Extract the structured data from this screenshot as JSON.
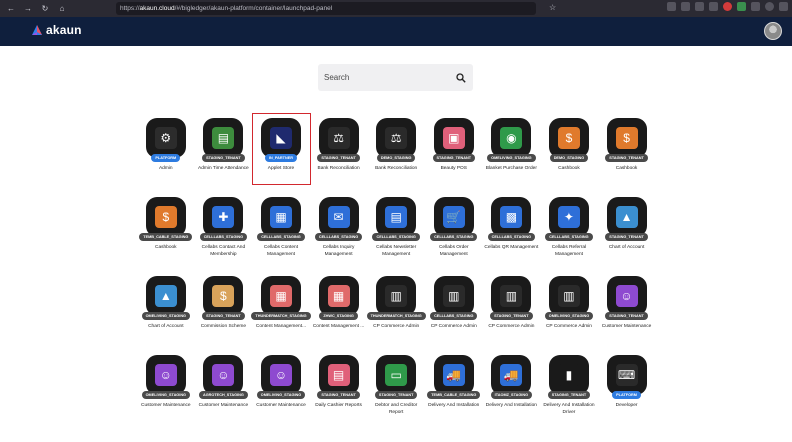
{
  "browser": {
    "url_prefix": "https://",
    "url_host": "akaun.cloud",
    "url_path": "/#/bigledger/akaun-platform/container/launchpad-panel"
  },
  "app": {
    "brand": "akaun"
  },
  "search": {
    "placeholder": "Search"
  },
  "apps": [
    {
      "label": "Admin",
      "badge": "PLATFORM",
      "badge_color": "#2d7be0",
      "icon_bg": "#2c2c2c",
      "glyph": "⚙"
    },
    {
      "label": "Admin Time Attendance",
      "badge": "STAGING_TENANT",
      "badge_color": "#4a4a4a",
      "icon_bg": "#3d8c3d",
      "glyph": "▤"
    },
    {
      "label": "Applet Store",
      "badge": "IN_PARTNER",
      "badge_color": "#2d7be0",
      "icon_bg": "#1f2a6e",
      "glyph": "◣",
      "selected": true
    },
    {
      "label": "Bank Reconciliation",
      "badge": "STAGING_TENANT",
      "badge_color": "#4a4a4a",
      "icon_bg": "#2a2a2a",
      "glyph": "⚖"
    },
    {
      "label": "Bank Reconciliation",
      "badge": "DEMO_STAGING",
      "badge_color": "#4a4a4a",
      "icon_bg": "#2a2a2a",
      "glyph": "⚖"
    },
    {
      "label": "Beauty POS",
      "badge": "STAGING_TENANT",
      "badge_color": "#4a4a4a",
      "icon_bg": "#e0607a",
      "glyph": "▣"
    },
    {
      "label": "Blanket Purchase Order",
      "badge": "OMELIVING_STAGING",
      "badge_color": "#4a4a4a",
      "icon_bg": "#2f9a4a",
      "glyph": "◉"
    },
    {
      "label": "Cashbook",
      "badge": "DEMO_STAGING",
      "badge_color": "#4a4a4a",
      "icon_bg": "#e07a2c",
      "glyph": "$"
    },
    {
      "label": "Cashbook",
      "badge": "STAGING_TENANT",
      "badge_color": "#4a4a4a",
      "icon_bg": "#e07a2c",
      "glyph": "$"
    },
    {
      "label": "Cashbook",
      "badge": "TEMB_CABLE_STAGING",
      "badge_color": "#4a4a4a",
      "icon_bg": "#e07a2c",
      "glyph": "$"
    },
    {
      "label": "Cellabs Contact And Membership",
      "badge": "CELLLABS_STAGING",
      "badge_color": "#4a4a4a",
      "icon_bg": "#2e6fd8",
      "glyph": "✚"
    },
    {
      "label": "Cellabs Content Management",
      "badge": "CELLLABS_STAGING",
      "badge_color": "#4a4a4a",
      "icon_bg": "#2e6fd8",
      "glyph": "▦"
    },
    {
      "label": "Cellabs Inquiry Management",
      "badge": "CELLLABS_STAGING",
      "badge_color": "#4a4a4a",
      "icon_bg": "#2e6fd8",
      "glyph": "✉"
    },
    {
      "label": "Cellabs Newsletter Management",
      "badge": "CELLLABS_STAGING",
      "badge_color": "#4a4a4a",
      "icon_bg": "#2e6fd8",
      "glyph": "▤"
    },
    {
      "label": "Cellabs Order Management",
      "badge": "CELLLABS_STAGING",
      "badge_color": "#4a4a4a",
      "icon_bg": "#2e6fd8",
      "glyph": "🛒"
    },
    {
      "label": "Cellabs QR Management",
      "badge": "CELLLABS_STAGING",
      "badge_color": "#4a4a4a",
      "icon_bg": "#2e6fd8",
      "glyph": "▩"
    },
    {
      "label": "Cellabs Referral Management",
      "badge": "CELLLABS_STAGING",
      "badge_color": "#4a4a4a",
      "icon_bg": "#2e6fd8",
      "glyph": "✦"
    },
    {
      "label": "Chart of Account",
      "badge": "STAGING_TENANT",
      "badge_color": "#4a4a4a",
      "icon_bg": "#3b8fd0",
      "glyph": "▲"
    },
    {
      "label": "Chart of Account",
      "badge": "OMELIVING_STAGING",
      "badge_color": "#4a4a4a",
      "icon_bg": "#3b8fd0",
      "glyph": "▲"
    },
    {
      "label": "Commission Scheme",
      "badge": "STAGING_TENANT",
      "badge_color": "#4a4a4a",
      "icon_bg": "#d9a35a",
      "glyph": "$"
    },
    {
      "label": "Content Management...",
      "badge": "THUNDERMATCH_STAGING",
      "badge_color": "#4a4a4a",
      "icon_bg": "#e06a6a",
      "glyph": "▦"
    },
    {
      "label": "Content Management ...",
      "badge": "ZHWC_STAGING",
      "badge_color": "#4a4a4a",
      "icon_bg": "#e06a6a",
      "glyph": "▦"
    },
    {
      "label": "CP Commerce Admin",
      "badge": "THUNDERMATCH_STAGING",
      "badge_color": "#4a4a4a",
      "icon_bg": "#2a2a2a",
      "glyph": "▥"
    },
    {
      "label": "CP Commerce Admin",
      "badge": "CELLLABS_STAGING",
      "badge_color": "#4a4a4a",
      "icon_bg": "#2a2a2a",
      "glyph": "▥"
    },
    {
      "label": "CP Commerce Admin",
      "badge": "STAGING_TENANT",
      "badge_color": "#4a4a4a",
      "icon_bg": "#2a2a2a",
      "glyph": "▥"
    },
    {
      "label": "CP Commerce Admin",
      "badge": "OMELIVING_STAGING",
      "badge_color": "#4a4a4a",
      "icon_bg": "#2a2a2a",
      "glyph": "▥"
    },
    {
      "label": "Customer Maintenance",
      "badge": "STAGING_TENANT",
      "badge_color": "#4a4a4a",
      "icon_bg": "#8e4ad0",
      "glyph": "☺"
    },
    {
      "label": "Customer Maintenance",
      "badge": "OMELIVING_STAGING",
      "badge_color": "#4a4a4a",
      "icon_bg": "#8e4ad0",
      "glyph": "☺"
    },
    {
      "label": "Customer Maintenance",
      "badge": "AGROTECH_STAGING",
      "badge_color": "#4a4a4a",
      "icon_bg": "#8e4ad0",
      "glyph": "☺"
    },
    {
      "label": "Customer Maintenance",
      "badge": "OMELIVING_STAGING",
      "badge_color": "#4a4a4a",
      "icon_bg": "#8e4ad0",
      "glyph": "☺"
    },
    {
      "label": "Daily Cashier Reports",
      "badge": "STAGING_TENANT",
      "badge_color": "#4a4a4a",
      "icon_bg": "#e0607a",
      "glyph": "▤"
    },
    {
      "label": "Debtor and Creditor Report",
      "badge": "STAGING_TENANT",
      "badge_color": "#4a4a4a",
      "icon_bg": "#2f9a4a",
      "glyph": "▭"
    },
    {
      "label": "Delivery And Installation",
      "badge": "TEMB_CABLE_STAGING",
      "badge_color": "#4a4a4a",
      "icon_bg": "#2e6fd8",
      "glyph": "🚚"
    },
    {
      "label": "Delivery And Installation",
      "badge": "ITAOMZ_STAGING",
      "badge_color": "#4a4a4a",
      "icon_bg": "#2e6fd8",
      "glyph": "🚚"
    },
    {
      "label": "Delivery And Installation Driver",
      "badge": "STAGING_TENANT",
      "badge_color": "#4a4a4a",
      "icon_bg": "#1a1a1a",
      "glyph": "▮"
    },
    {
      "label": "Developer",
      "badge": "PLATFORM",
      "badge_color": "#2d7be0",
      "icon_bg": "#2a2a2a",
      "glyph": "⌨"
    }
  ]
}
